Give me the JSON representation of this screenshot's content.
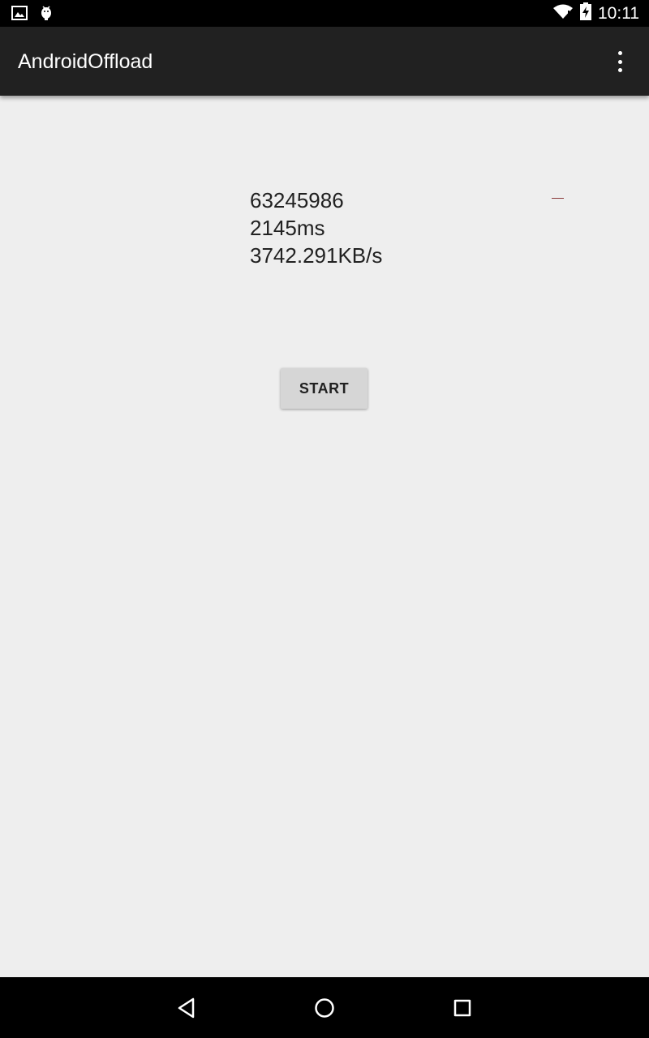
{
  "status_bar": {
    "time": "10:11",
    "icons": [
      "image-icon",
      "android-debug-icon",
      "wifi-icon",
      "battery-charging-icon"
    ]
  },
  "app_bar": {
    "title": "AndroidOffload",
    "overflow_icon": "more-vert-icon"
  },
  "results": {
    "bytes": "63245986",
    "duration": "2145ms",
    "throughput": "3742.291KB/s"
  },
  "actions": {
    "start_label": "START"
  },
  "nav_bar": {
    "icons": [
      "back-icon",
      "home-icon",
      "recents-icon"
    ]
  },
  "colors": {
    "status_bar": "#000000",
    "app_bar": "#212121",
    "background": "#eeeeee",
    "button": "#d6d6d6",
    "text": "#212121"
  }
}
